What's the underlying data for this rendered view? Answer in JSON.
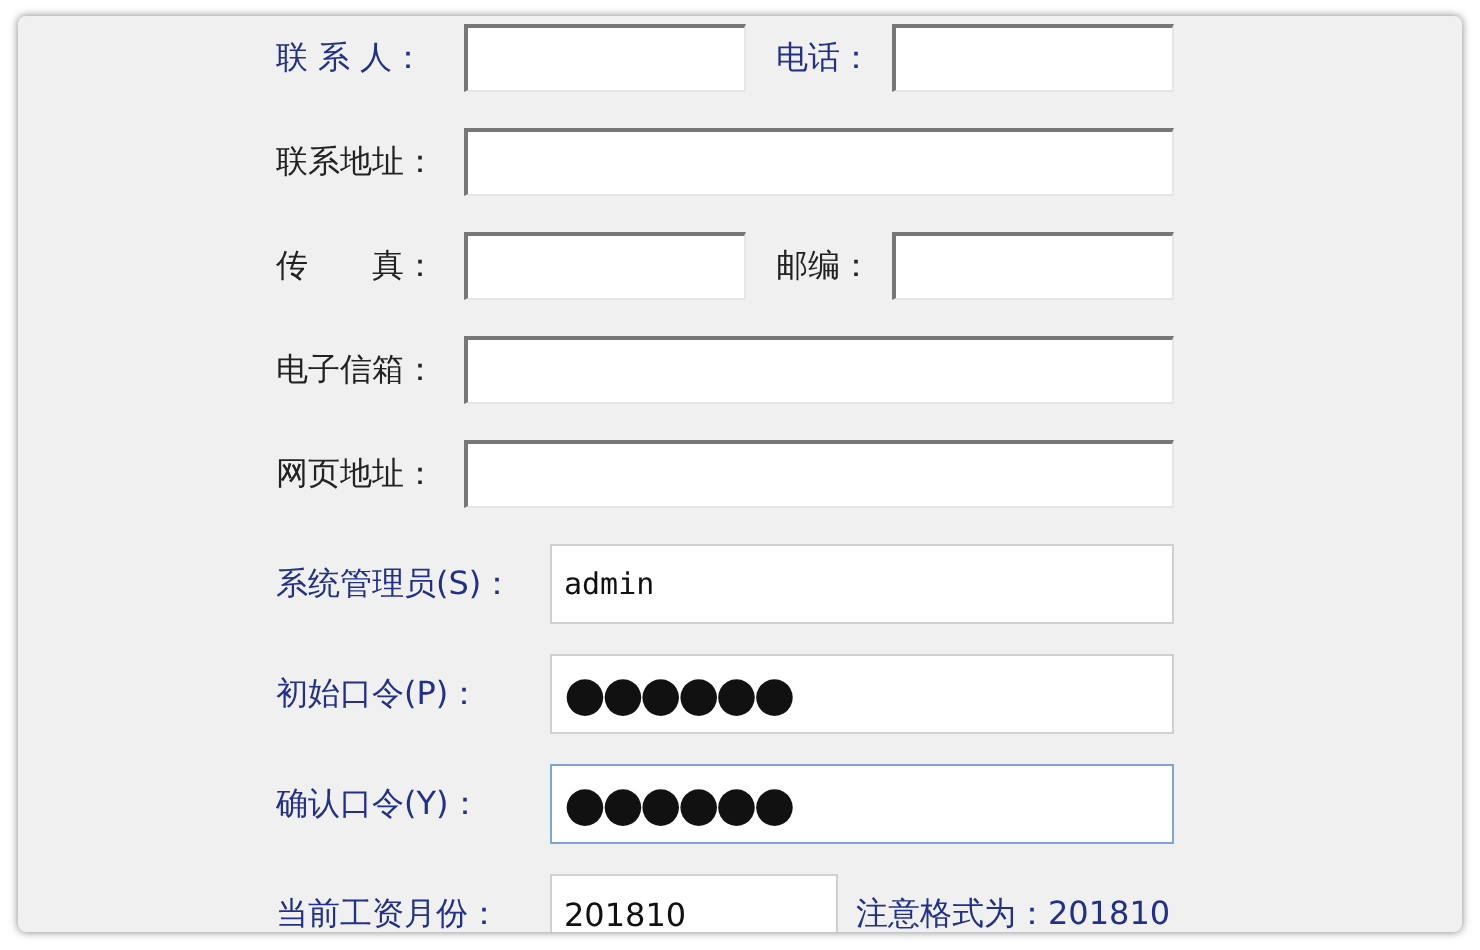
{
  "contact_rows": [
    {
      "fields": [
        {
          "label": "联 系 人：",
          "color": "#22308c"
        },
        {
          "label": "电话：",
          "color": "#22308c"
        }
      ]
    },
    {
      "fields": [
        {
          "label": "联系地址：",
          "color": "#222222"
        }
      ]
    },
    {
      "fields": [
        {
          "label": "传　　真：",
          "color": "#222222"
        },
        {
          "label": "邮编：",
          "color": "#222222"
        }
      ]
    },
    {
      "fields": [
        {
          "label": "电子信箱：",
          "color": "#222222"
        }
      ]
    },
    {
      "fields": [
        {
          "label": "网页地址：",
          "color": "#222222"
        }
      ]
    }
  ],
  "account_rows": [
    {
      "label": "系统管理员(S)：",
      "value": "admin",
      "kind": "text",
      "focused": false
    },
    {
      "label": "初始口令(P)：",
      "value": "●●●●●●",
      "kind": "password",
      "focused": false
    },
    {
      "label": "确认口令(Y)：",
      "value": "●●●●●●",
      "kind": "password",
      "focused": true
    },
    {
      "label": "当前工资月份：",
      "value": "201810",
      "kind": "month",
      "focused": false,
      "note": "注意格式为：201810"
    }
  ]
}
